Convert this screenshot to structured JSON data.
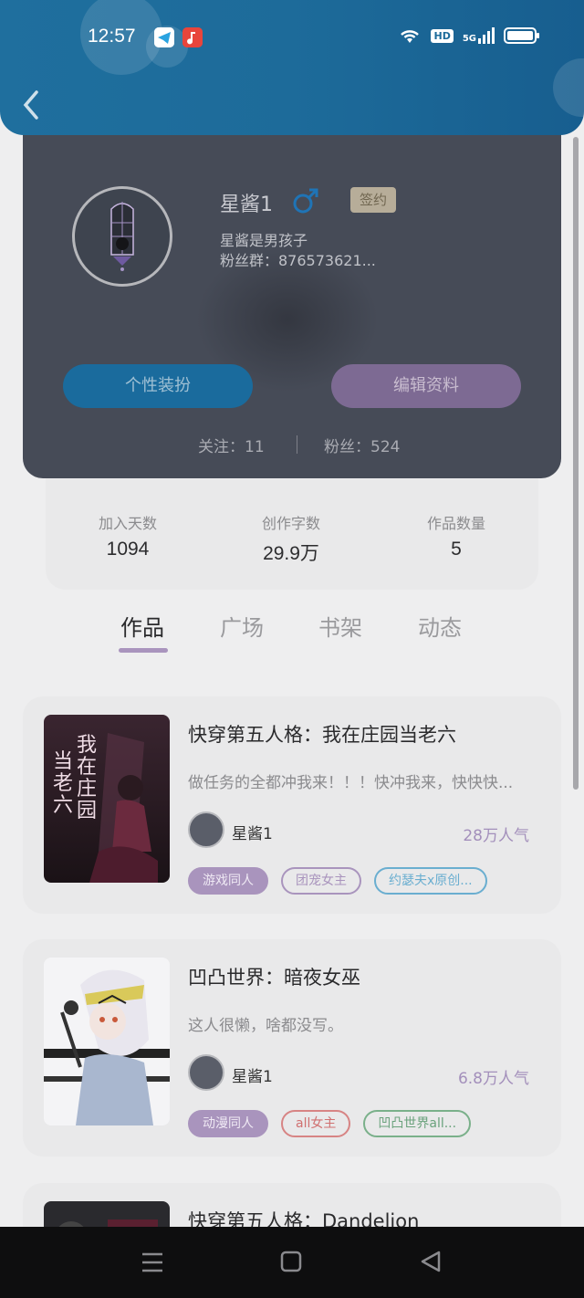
{
  "status_bar": {
    "time": "12:57",
    "network": "5G",
    "hd": "HD"
  },
  "profile": {
    "username": "星酱1",
    "gender": "male",
    "badge": "签约",
    "bio": "星酱是男孩子",
    "fans_group": "粉丝群：876573621...",
    "dress_button": "个性装扮",
    "edit_button": "编辑资料",
    "following": "关注：11",
    "followers": "粉丝：524"
  },
  "stats": [
    {
      "label": "加入天数",
      "value": "1094"
    },
    {
      "label": "创作字数",
      "value": "29.9万"
    },
    {
      "label": "作品数量",
      "value": "5"
    }
  ],
  "tabs": [
    {
      "label": "作品",
      "active": true
    },
    {
      "label": "广场",
      "active": false
    },
    {
      "label": "书架",
      "active": false
    },
    {
      "label": "动态",
      "active": false
    }
  ],
  "books": [
    {
      "title": "快穿第五人格：我在庄园当老六",
      "description": "做任务的全都冲我来！！！快冲我来，快快快...",
      "author": "星酱1",
      "popularity": "28万人气",
      "tags": [
        "游戏同人",
        "团宠女主",
        "约瑟夫x原创..."
      ],
      "cover_text": "我在庄园当老六"
    },
    {
      "title": "凹凸世界：暗夜女巫",
      "description": "这人很懒，啥都没写。",
      "author": "星酱1",
      "popularity": "6.8万人气",
      "tags": [
        "动漫同人",
        "all女主",
        "凹凸世界all..."
      ]
    },
    {
      "title": "快穿第五人格：Dandelion"
    }
  ],
  "colors": {
    "header": "#1d6b9a",
    "card": "#464b57",
    "accent_purple": "#a994bd",
    "accent_blue": "#1a6b9d"
  }
}
